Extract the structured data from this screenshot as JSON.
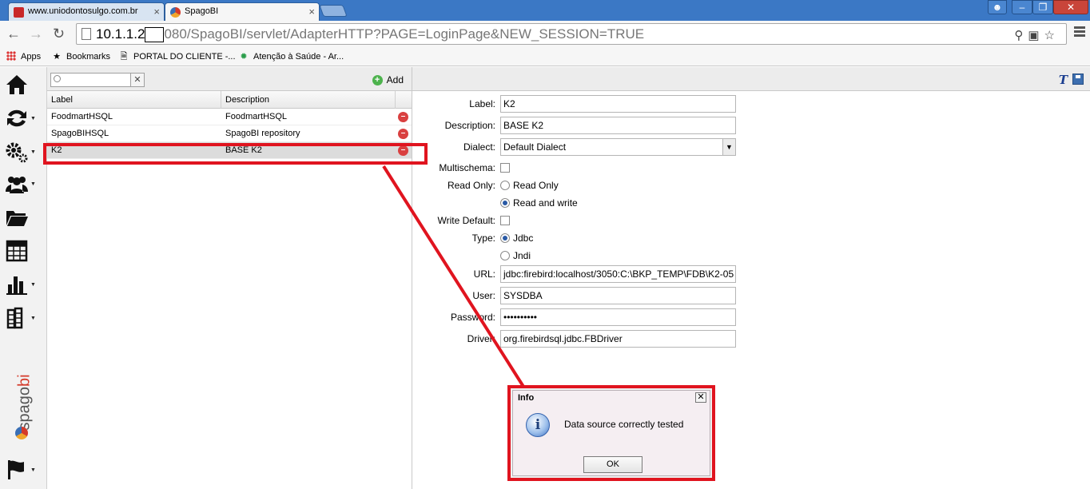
{
  "browser": {
    "tabs": [
      {
        "label": "www.uniodontosulgo.com.br",
        "active": false
      },
      {
        "label": "SpagoBI",
        "active": true
      }
    ],
    "url_host": "10.1.1.2",
    "url_rest": "080/SpagoBI/servlet/AdapterHTTP?PAGE=LoginPage&NEW_SESSION=TRUE",
    "bookmarks": [
      {
        "label": "Apps",
        "icon": "apps-grid-icon"
      },
      {
        "label": "Bookmarks",
        "icon": "star-icon"
      },
      {
        "label": "PORTAL DO CLIENTE -...",
        "icon": "page-icon"
      },
      {
        "label": "Atenção à Saúde - Ar...",
        "icon": "site-icon"
      }
    ]
  },
  "sidebar": {
    "icons": [
      "home-icon",
      "swap-icon",
      "gears-icon",
      "users-icon",
      "folder-icon",
      "spreadsheet-icon",
      "bar-chart-icon",
      "stacked-books-icon",
      "flag-icon"
    ],
    "logo_main": "spago",
    "logo_accent": "bi"
  },
  "list": {
    "add_label": "Add",
    "search_placeholder": "",
    "columns": [
      "Label",
      "Description"
    ],
    "rows": [
      {
        "label": "FoodmartHSQL",
        "description": "FoodmartHSQL",
        "selected": false
      },
      {
        "label": "SpagoBIHSQL",
        "description": "SpagoBI repository",
        "selected": false
      },
      {
        "label": "K2",
        "description": "BASE K2",
        "selected": true
      }
    ]
  },
  "form": {
    "label_label": "Label:",
    "label_value": "K2",
    "description_label": "Description:",
    "description_value": "BASE K2",
    "dialect_label": "Dialect:",
    "dialect_value": "Default Dialect",
    "multischema_label": "Multischema:",
    "readonly_label": "Read Only:",
    "readonly_option": "Read Only",
    "readwrite_option": "Read and write",
    "writedefault_label": "Write Default:",
    "type_label": "Type:",
    "type_jdbc": "Jdbc",
    "type_jndi": "Jndi",
    "url_label": "URL:",
    "url_value": "jdbc:firebird:localhost/3050:C:\\BKP_TEMP\\FDB\\K2-05",
    "user_label": "User:",
    "user_value": "SYSDBA",
    "password_label": "Password:",
    "password_value": "••••••••••",
    "driver_label": "Driver:",
    "driver_value": "org.firebirdsql.jdbc.FBDriver"
  },
  "dialog": {
    "title": "Info",
    "message": "Data source correctly tested",
    "ok_label": "OK"
  },
  "colors": {
    "annotation_red": "#e0141f",
    "chrome_blue": "#3b78c5",
    "delete_red": "#d94040",
    "add_green": "#4db34d"
  }
}
